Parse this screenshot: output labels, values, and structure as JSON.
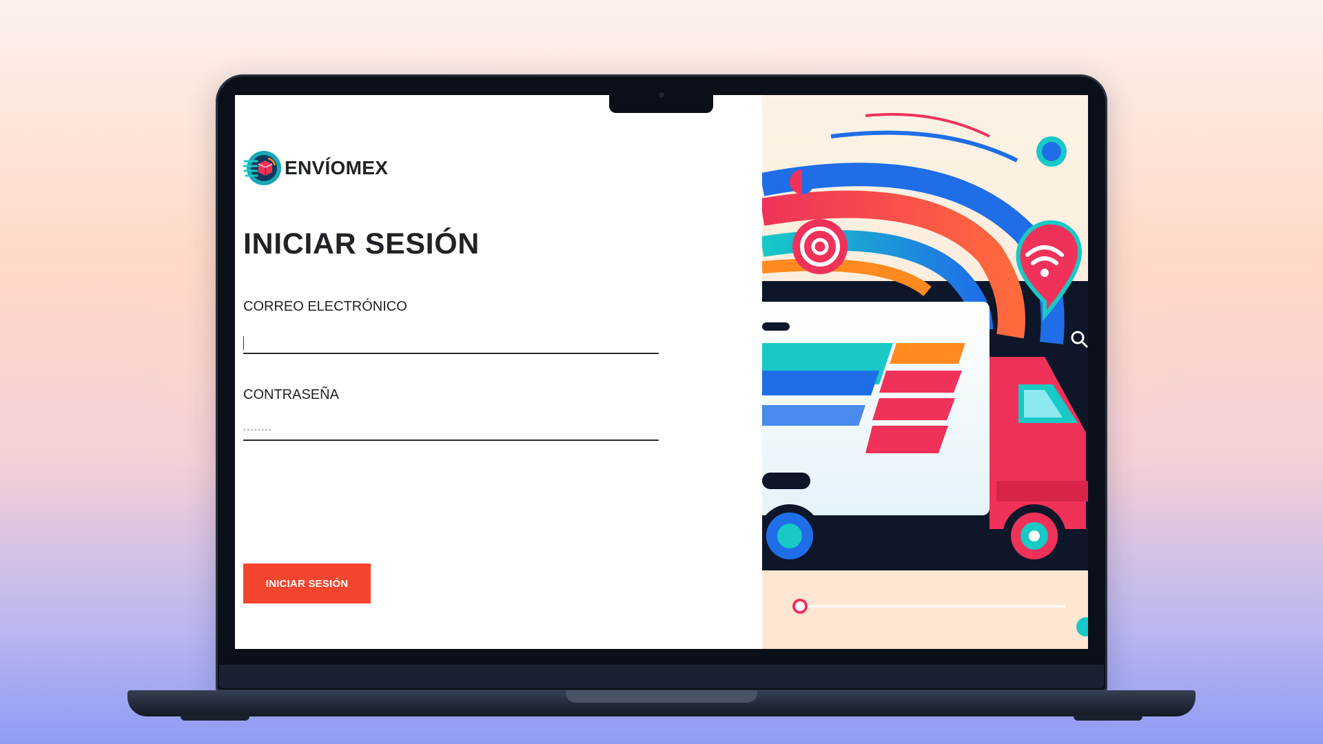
{
  "brand": {
    "name": "ENVÍOMEX",
    "logo_icon": "package-delivery-logo-icon"
  },
  "login": {
    "title": "INICIAR SESIÓN",
    "email_label": "CORREO ELECTRÓNICO",
    "email_value": "",
    "password_label": "CONTRASEÑA",
    "password_placeholder": "••••••••",
    "submit_label": "INICIAR SESIÓN"
  },
  "colors": {
    "accent": "#f4452e",
    "text": "#1f2226",
    "hero_pink": "#f0325a",
    "hero_blue": "#1f6ee8",
    "hero_teal": "#18c9c6",
    "hero_orange": "#ff8a1f"
  },
  "hero": {
    "illustration": "delivery-truck-illustration",
    "icons": [
      "wifi-pin-icon",
      "target-icon",
      "search-icon"
    ]
  }
}
